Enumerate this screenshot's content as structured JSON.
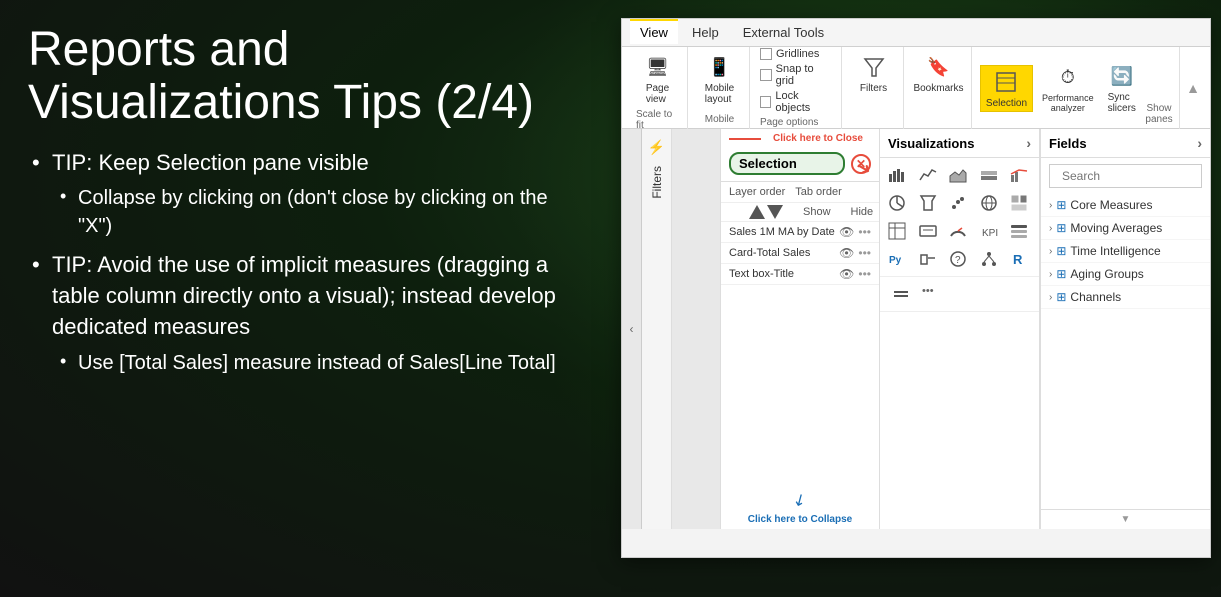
{
  "title": "Reports and Visualizations Tips (2/4)",
  "bullets": [
    {
      "text": "TIP: Keep Selection pane visible",
      "sub": [
        "Collapse by clicking on (don't close by clicking on the \"X\")"
      ]
    },
    {
      "text": "TIP: Avoid the use of implicit measures (dragging a table column directly onto a visual); instead develop dedicated measures",
      "sub": [
        "Use [Total Sales] measure instead of Sales[Line Total]"
      ]
    }
  ],
  "ribbon": {
    "tabs": [
      "View",
      "Help",
      "External Tools"
    ],
    "active_tab": "View",
    "page_options": {
      "label": "Page options",
      "items": [
        "Gridlines",
        "Snap to grid",
        "Lock objects"
      ]
    },
    "scale_to_fit": "Scale to fit",
    "mobile": "Mobile",
    "show_panes": "Show panes",
    "buttons": {
      "page_view": "Page\nview",
      "mobile_layout": "Mobile\nlayout",
      "filters": "Filters",
      "bookmarks": "Bookmarks",
      "selection": "Selection",
      "performance_analyzer": "Performance\nanalyzer",
      "sync_slicers": "Sync\nslicers"
    }
  },
  "selection_pane": {
    "title": "Selection",
    "close_tooltip": "Click here to Close",
    "layer_order": "Layer order",
    "tab_order": "Tab order",
    "show": "Show",
    "hide": "Hide",
    "items": [
      "Sales 1M MA by Date",
      "Card-Total Sales",
      "Text box-Title"
    ],
    "collapse_label": "Click here to Collapse"
  },
  "viz_pane": {
    "title": "Visualizations",
    "icons": [
      "📊",
      "📈",
      "📉",
      "📋",
      "🗂",
      "🔲",
      "🗃",
      "🔵",
      "🕐",
      "📌",
      "Py",
      "📎",
      "💬",
      "📁",
      "R",
      "🔗",
      "⊞",
      "🔲",
      "🧱",
      "⚙"
    ]
  },
  "fields_pane": {
    "title": "Fields",
    "search_placeholder": "Search",
    "groups": [
      "Core Measures",
      "Moving Averages",
      "Time Intelligence",
      "Aging Groups",
      "Channels"
    ]
  },
  "colors": {
    "accent_green": "#2e7d32",
    "accent_red": "#e74c3c",
    "accent_blue": "#1a6eb5",
    "click_close_color": "#e74c3c",
    "click_collapse_color": "#1a6eb5"
  }
}
